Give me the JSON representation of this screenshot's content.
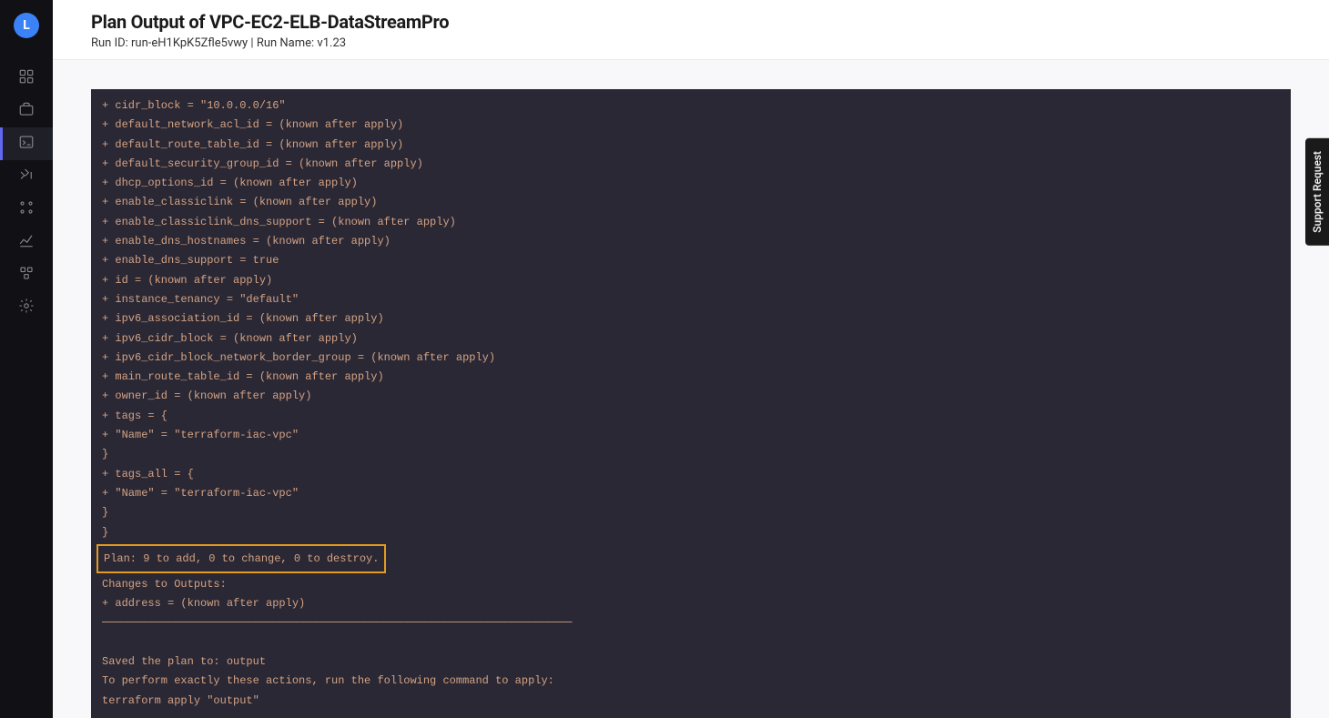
{
  "logo_letter": "L",
  "header": {
    "title_prefix": "Plan Output of ",
    "title_name": "VPC-EC2-ELB-DataStreamPro",
    "subtitle": "Run ID: run-eH1KpK5Zfle5vwy | Run Name: v1.23"
  },
  "support": "Support Request",
  "code": {
    "lines": [
      "+ cidr_block = \"10.0.0.0/16\"",
      "+ default_network_acl_id = (known after apply)",
      "+ default_route_table_id = (known after apply)",
      "+ default_security_group_id = (known after apply)",
      "+ dhcp_options_id = (known after apply)",
      "+ enable_classiclink = (known after apply)",
      "+ enable_classiclink_dns_support = (known after apply)",
      "+ enable_dns_hostnames = (known after apply)",
      "+ enable_dns_support = true",
      "+ id = (known after apply)",
      "+ instance_tenancy = \"default\"",
      "+ ipv6_association_id = (known after apply)",
      "+ ipv6_cidr_block = (known after apply)",
      "+ ipv6_cidr_block_network_border_group = (known after apply)",
      "+ main_route_table_id = (known after apply)",
      "+ owner_id = (known after apply)",
      "+ tags = {",
      "+ \"Name\" = \"terraform-iac-vpc\"",
      "}",
      "+ tags_all = {",
      "+ \"Name\" = \"terraform-iac-vpc\"",
      "}",
      "}"
    ],
    "highlighted": "Plan: 9 to add, 0 to change, 0 to destroy.",
    "after": [
      "Changes to Outputs:",
      "+ address = (known after apply)"
    ],
    "dashes": "─────────────────────────────────────────────────────────────────────────────",
    "tail": [
      "",
      "Saved the plan to: output",
      "To perform exactly these actions, run the following command to apply:",
      "terraform apply \"output\""
    ]
  }
}
